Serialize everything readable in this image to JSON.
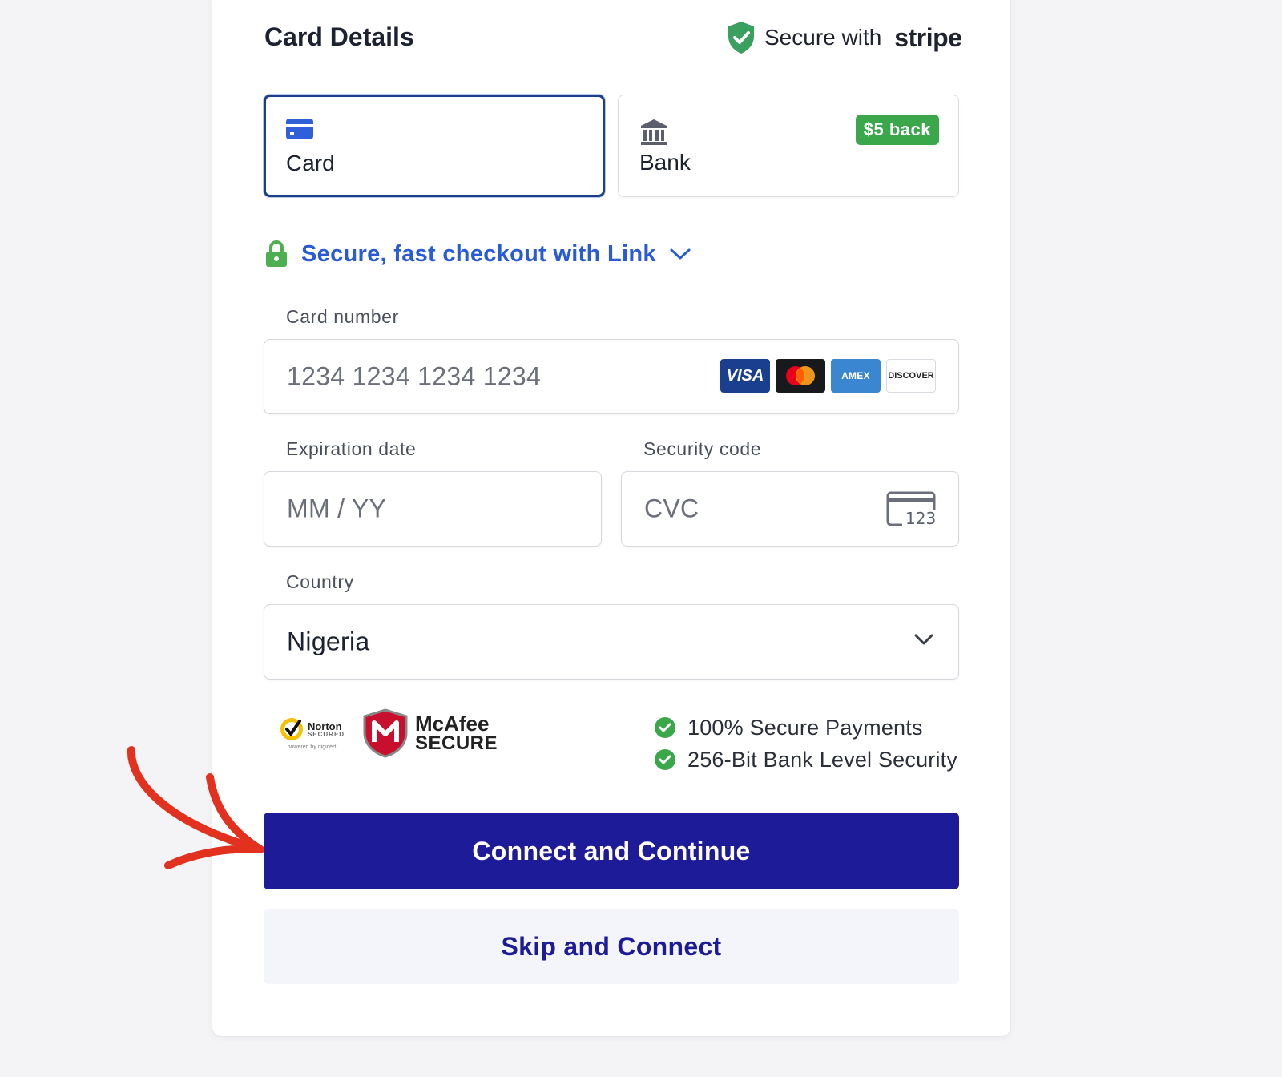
{
  "header": {
    "title": "Card Details",
    "secure_prefix": "Secure with",
    "secure_brand": "stripe"
  },
  "payment_methods": [
    {
      "label": "Card",
      "icon": "credit-card-icon",
      "selected": true
    },
    {
      "label": "Bank",
      "icon": "bank-icon",
      "selected": false,
      "badge": "$5 back"
    }
  ],
  "link_checkout": {
    "label": "Secure, fast checkout with Link",
    "icon": "lock-icon"
  },
  "form": {
    "card_number": {
      "label": "Card number",
      "placeholder": "1234 1234 1234 1234"
    },
    "card_brands": [
      "VISA",
      "mastercard",
      "AMEX",
      "DISCOVER"
    ],
    "expiration": {
      "label": "Expiration date",
      "placeholder": "MM / YY"
    },
    "security_code": {
      "label": "Security code",
      "placeholder": "CVC",
      "icon_text": "123"
    },
    "country": {
      "label": "Country",
      "value": "Nigeria"
    }
  },
  "trust_badges": {
    "norton": {
      "name": "Norton",
      "sub": "SECURED",
      "powered": "powered by digicert"
    },
    "mcafee": {
      "line1": "McAfee",
      "line2": "SECURE"
    }
  },
  "assurances": [
    "100% Secure Payments",
    "256-Bit Bank Level Security"
  ],
  "actions": {
    "primary": "Connect and Continue",
    "secondary": "Skip and Connect"
  },
  "colors": {
    "primary": "#1d1b98",
    "link": "#2a5bd7",
    "success": "#3aa84a",
    "annotation_arrow": "#e2321f"
  }
}
